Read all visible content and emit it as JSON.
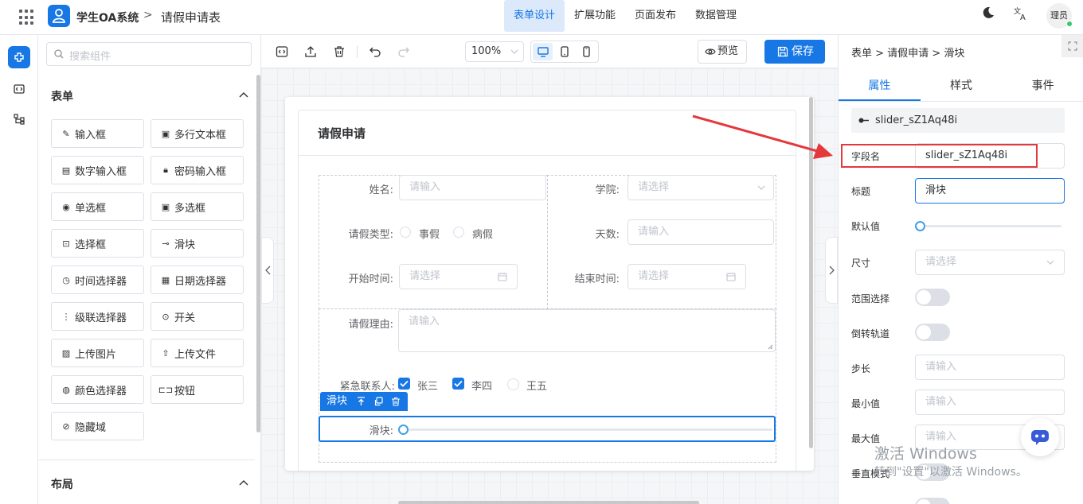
{
  "header": {
    "app_name": "学生OA系统",
    "separator": ">",
    "page_name": "请假申请表",
    "nav": [
      "表单设计",
      "扩展功能",
      "页面发布",
      "数据管理"
    ],
    "active_nav": "表单设计",
    "avatar_text": "理员"
  },
  "palette": {
    "search_placeholder": "搜索组件",
    "section_form": "表单",
    "section_layout": "布局",
    "components": [
      {
        "label": "输入框",
        "icon": "pencil-icon"
      },
      {
        "label": "多行文本框",
        "icon": "textarea-icon"
      },
      {
        "label": "数字输入框",
        "icon": "number-input-icon"
      },
      {
        "label": "密码输入框",
        "icon": "lock-icon"
      },
      {
        "label": "单选框",
        "icon": "radio-icon"
      },
      {
        "label": "多选框",
        "icon": "checkbox-icon"
      },
      {
        "label": "选择框",
        "icon": "select-icon"
      },
      {
        "label": "滑块",
        "icon": "slider-icon"
      },
      {
        "label": "时间选择器",
        "icon": "clock-icon"
      },
      {
        "label": "日期选择器",
        "icon": "calendar-icon"
      },
      {
        "label": "级联选择器",
        "icon": "cascader-icon"
      },
      {
        "label": "开关",
        "icon": "switch-icon"
      },
      {
        "label": "上传图片",
        "icon": "image-icon"
      },
      {
        "label": "上传文件",
        "icon": "upload-icon"
      },
      {
        "label": "颜色选择器",
        "icon": "palette-icon"
      },
      {
        "label": "按钮",
        "icon": "button-icon"
      },
      {
        "label": "隐藏域",
        "icon": "eye-off-icon"
      }
    ]
  },
  "toolbar": {
    "zoom": "100%",
    "preview": "预览",
    "save": "保存"
  },
  "form": {
    "title": "请假申请",
    "name_label": "姓名:",
    "name_placeholder": "请输入",
    "college_label": "学院:",
    "college_placeholder": "请选择",
    "leave_type_label": "请假类型:",
    "leave_type_options": [
      "事假",
      "病假"
    ],
    "days_label": "天数:",
    "days_placeholder": "请输入",
    "start_label": "开始时间:",
    "start_placeholder": "请选择",
    "end_label": "结束时间:",
    "end_placeholder": "请选择",
    "reason_label": "请假理由:",
    "reason_placeholder": "请输入",
    "contact_label": "紧急联系人:",
    "contacts": [
      {
        "name": "张三",
        "checked": true
      },
      {
        "name": "李四",
        "checked": true
      },
      {
        "name": "王五",
        "checked": false
      }
    ],
    "slider_toolbar_label": "滑块",
    "slider_label": "滑块:",
    "slider_value": 0
  },
  "props": {
    "breadcrumb": "表单 > 请假申请 > 滑块",
    "tabs": [
      "属性",
      "样式",
      "事件"
    ],
    "active_tab": "属性",
    "component_id": "slider_sZ1Aq48i",
    "field_name_label": "字段名",
    "field_name_value": "slider_sZ1Aq48i",
    "title_label": "标题",
    "title_value": "滑块",
    "default_label": "默认值",
    "size_label": "尺寸",
    "size_placeholder": "请选择",
    "range_label": "范围选择",
    "reverse_label": "倒转轨道",
    "step_label": "步长",
    "step_placeholder": "请输入",
    "min_label": "最小值",
    "min_placeholder": "请输入",
    "max_label": "最大值",
    "max_placeholder": "请输入",
    "vertical_label": "垂直模式"
  },
  "watermark": {
    "line1": "激活 Windows",
    "line2": "转到\"设置\"以激活 Windows。"
  },
  "colors": {
    "accent": "#1677e5",
    "highlight": "#e4393c"
  }
}
